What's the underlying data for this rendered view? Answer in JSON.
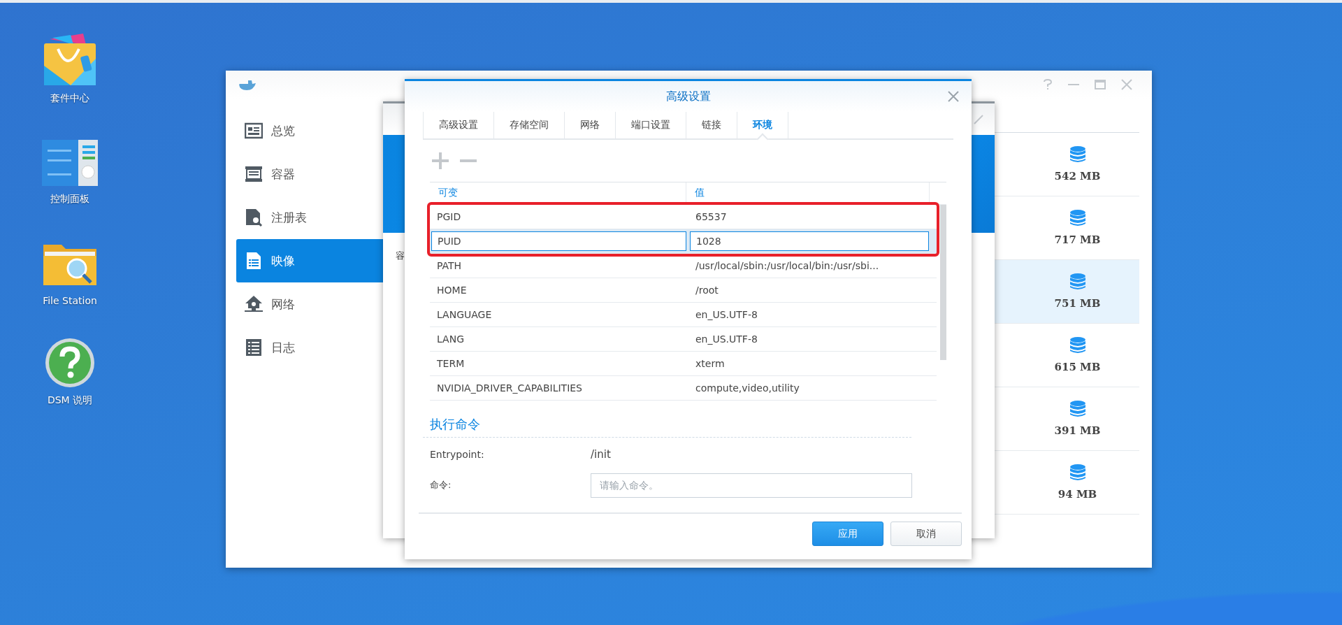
{
  "desktop_icons": [
    {
      "label": "套件中心",
      "kind": "package"
    },
    {
      "label": "控制面板",
      "kind": "panel"
    },
    {
      "label": "File Station",
      "kind": "folder"
    },
    {
      "label": "DSM 说明",
      "kind": "help"
    }
  ],
  "main_window": {
    "sidebar": [
      {
        "label": "总览",
        "selected": false
      },
      {
        "label": "容器",
        "selected": false
      },
      {
        "label": "注册表",
        "selected": false
      },
      {
        "label": "映像",
        "selected": true
      },
      {
        "label": "网络",
        "selected": false
      },
      {
        "label": "日志",
        "selected": false
      }
    ],
    "image_sizes": [
      {
        "size": "542 MB",
        "selected": false
      },
      {
        "size": "717 MB",
        "selected": false
      },
      {
        "size": "751 MB",
        "selected": true
      },
      {
        "size": "615 MB",
        "selected": false
      },
      {
        "size": "391 MB",
        "selected": false
      },
      {
        "size": "94 MB",
        "selected": false
      }
    ]
  },
  "behind_window": {
    "label_fragment": "容"
  },
  "dialog": {
    "title": "高级设置",
    "tabs": [
      {
        "label": "高级设置",
        "selected": false
      },
      {
        "label": "存储空间",
        "selected": false
      },
      {
        "label": "网络",
        "selected": false
      },
      {
        "label": "端口设置",
        "selected": false
      },
      {
        "label": "链接",
        "selected": false
      },
      {
        "label": "环境",
        "selected": true
      }
    ],
    "table": {
      "columns": [
        "可变",
        "值"
      ],
      "rows": [
        {
          "variable": "PGID",
          "value": "65537",
          "selected": false,
          "highlighted": true
        },
        {
          "variable": "PUID",
          "value": "1028",
          "selected": true,
          "highlighted": true
        },
        {
          "variable": "PATH",
          "value": "/usr/local/sbin:/usr/local/bin:/usr/sbi...",
          "selected": false
        },
        {
          "variable": "HOME",
          "value": "/root",
          "selected": false
        },
        {
          "variable": "LANGUAGE",
          "value": "en_US.UTF-8",
          "selected": false
        },
        {
          "variable": "LANG",
          "value": "en_US.UTF-8",
          "selected": false
        },
        {
          "variable": "TERM",
          "value": "xterm",
          "selected": false
        },
        {
          "variable": "NVIDIA_DRIVER_CAPABILITIES",
          "value": "compute,video,utility",
          "selected": false
        }
      ]
    },
    "section_title": "执行命令",
    "entrypoint": {
      "label": "Entrypoint:",
      "value": "/init"
    },
    "command": {
      "label": "命令:",
      "placeholder": "请输入命令。"
    },
    "buttons": [
      {
        "label": "应用",
        "kind": "primary"
      },
      {
        "label": "取消",
        "kind": "secondary"
      }
    ]
  }
}
